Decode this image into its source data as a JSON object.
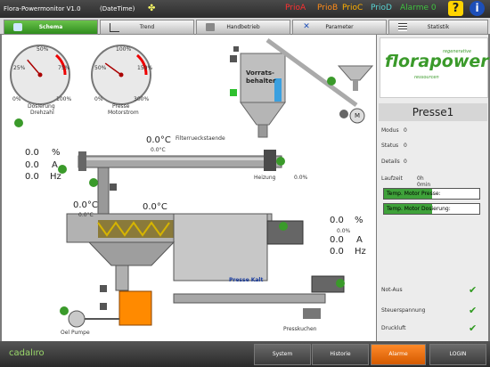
{
  "titlebar": {
    "title": "Flora-Powermonitor V1.0",
    "datetime": "(DateTime)",
    "prio_a": "PrioA",
    "prio_b": "PrioB",
    "prio_c": "PrioC",
    "prio_d": "PrioD",
    "alarme": "Alarme 0",
    "colors": {
      "prio_a": "#ff3030",
      "prio_b": "#ff8c1a",
      "prio_c": "#ffb000",
      "prio_d": "#58d2d2",
      "alarme": "#40c040"
    }
  },
  "tabs": [
    "Schema",
    "Trend",
    "Handbetrieb",
    "Parameter",
    "Statistik"
  ],
  "gauges": {
    "left": {
      "ticks": [
        "0%",
        "25%",
        "50%",
        "75%",
        "100%"
      ],
      "label1": "Dosierung",
      "label2": "Drehzahl",
      "value_fraction": 0.35
    },
    "right": {
      "ticks": [
        "0%",
        "50%",
        "100%",
        "150%",
        "200%",
        "300%"
      ],
      "label1": "Presse",
      "label2": "Motorstrom",
      "value_fraction": 0.3
    }
  },
  "schema": {
    "vorrats": "Vorrats-",
    "behalter": "behalter",
    "motor_m": "M",
    "filter": "Filterrueckstaende",
    "heizung": "Heizung",
    "heizung_pct": "0.0%",
    "temp_top": "0.0°C",
    "temp_top_small": "0.0°C",
    "temp_mid": "0.0°C",
    "temp_mid_small": "0.0°C",
    "temp_right": "0.0°C",
    "left_readout": [
      {
        "v": "0.0",
        "u": "%"
      },
      {
        "v": "0.0",
        "u": "A"
      },
      {
        "v": "0.0",
        "u": "Hz"
      }
    ],
    "right_readout": [
      {
        "v": "0.0",
        "u": "%"
      },
      {
        "v": "0.0",
        "u": "A"
      },
      {
        "v": "0.0",
        "u": "Hz"
      }
    ],
    "right_small_pct": "0.0%",
    "presse_kalt": "Presse Kalt",
    "presskuchen": "Presskuchen",
    "oel_pumpe": "Oel Pumpe"
  },
  "right_panel": {
    "brand": "florapower",
    "brand_sub1": "regenerative",
    "brand_sub2": "ressourcen",
    "title": "Presse1",
    "fields": [
      {
        "label": "Modus",
        "value": "0"
      },
      {
        "label": "Status",
        "value": "0"
      },
      {
        "label": "Details",
        "value": "0"
      }
    ],
    "laufzeit_label": "Laufzeit",
    "laufzeit_value": "0h  0min",
    "bar1": "Temp. Motor Presse:",
    "bar1_fraction": 0.5,
    "bar2": "Temp. Motor Dosierung:",
    "bar2_fraction": 0.5,
    "status_items": [
      "Not-Aus",
      "Steuerspannung",
      "Druckluft"
    ],
    "check_color": "#2f9a1f"
  },
  "footer": {
    "logo": "cadalıro",
    "buttons": [
      "System",
      "Historie",
      "Alarme",
      "LOGIN"
    ]
  }
}
